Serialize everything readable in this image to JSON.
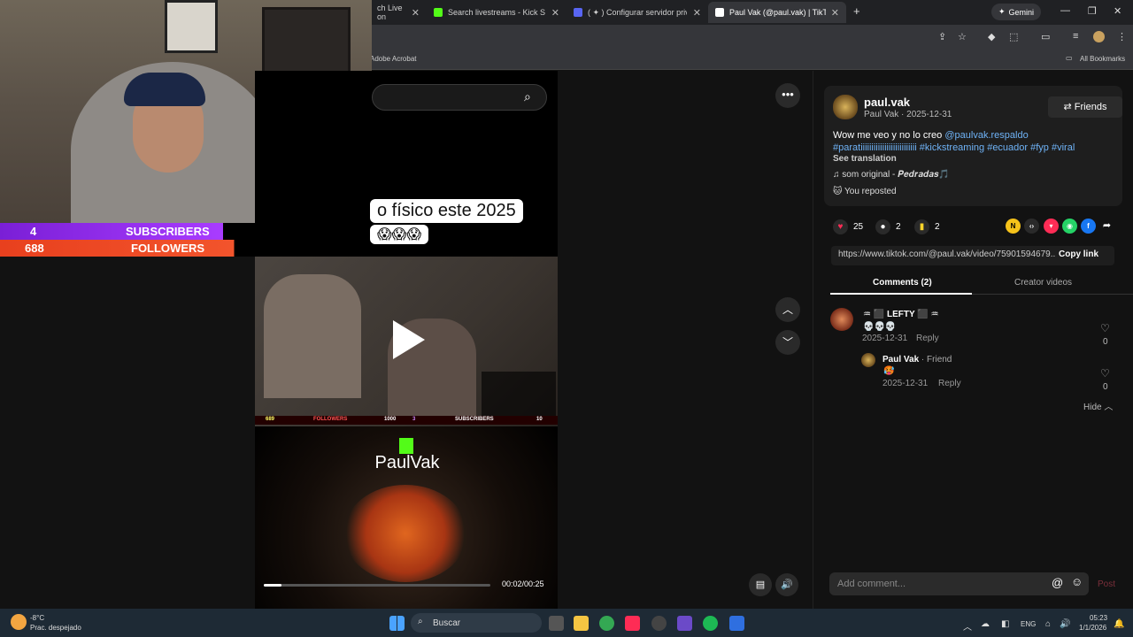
{
  "browser": {
    "tabs": [
      {
        "label": "ch Live on",
        "icon": "tiktok-live-icon",
        "color": "#ffffff",
        "active": false
      },
      {
        "label": "Search livestreams - Kick Stream",
        "icon": "kick-icon",
        "color": "#53fc18",
        "active": false
      },
      {
        "label": "( ✦ ) Configurar servidor privad",
        "icon": "discord-icon",
        "color": "#5865f2",
        "active": false
      },
      {
        "label": "Paul Vak (@paul.vak) | TikTok",
        "icon": "tiktok-icon",
        "color": "#ffffff",
        "active": true
      }
    ],
    "new_tab": "+",
    "gemini_label": "Gemini",
    "bookmark_adobe": "Adobe Acrobat",
    "bookmark_all": "All Bookmarks"
  },
  "stream": {
    "subscribers_label": "SUBSCRIBERS",
    "subscribers_count": "4",
    "subscribers_goal": "10",
    "followers_label": "FOLLOWERS",
    "followers_count": "688",
    "followers_goal": "1000",
    "mini_followers_count": "689",
    "mini_followers_label": "FOLLOWERS",
    "mini_followers_goal": "1000",
    "mini_subs_count": "3",
    "mini_subs_label": "SUBSCRIBERS",
    "mini_subs_goal": "10"
  },
  "video": {
    "caption": "o físico este 2025",
    "emojis": "😱😱😱",
    "brand_name": "PaulVak",
    "time": "00:02/00:25",
    "progress": 0.08
  },
  "post": {
    "username": "paul.vak",
    "subtitle": "Paul Vak · 2025-12-31",
    "friends_label": "Friends",
    "desc_text": "Wow me veo y no lo creo ",
    "mention": "@paulvak.respaldo",
    "tags": "#paratiiiiiiiiiiiiiiiiiiiiiiiiii #kickstreaming #ecuador #fyp #viral",
    "see_translation": "See translation",
    "music": "som original - 𝑷𝒆𝒅𝒓𝒂𝒅𝒂𝒔🎵",
    "repost": "You reposted",
    "likes": "25",
    "comments": "2",
    "saves": "2",
    "link": "https://www.tiktok.com/@paul.vak/video/75901594679...",
    "copy_link": "Copy link",
    "tab_comments": "Comments (2)",
    "tab_creator": "Creator videos"
  },
  "comments": [
    {
      "name": "♒ ⬛ LEFTY ⬛ ♒",
      "text": "💀💀💀",
      "date": "2025-12-31",
      "reply": "Reply",
      "likes": "0"
    },
    {
      "name": "Paul Vak",
      "badge": " · Friend",
      "text": "🥵",
      "date": "2025-12-31",
      "reply": "Reply",
      "likes": "0"
    }
  ],
  "hide_label": "Hide",
  "comment_input": {
    "placeholder": "Add comment...",
    "post": "Post"
  },
  "taskbar": {
    "temp": "-8°C",
    "weather": "Prac. despejado",
    "search": "Buscar",
    "lang": "ENG",
    "time": "05:23",
    "date": "1/1/2026"
  }
}
